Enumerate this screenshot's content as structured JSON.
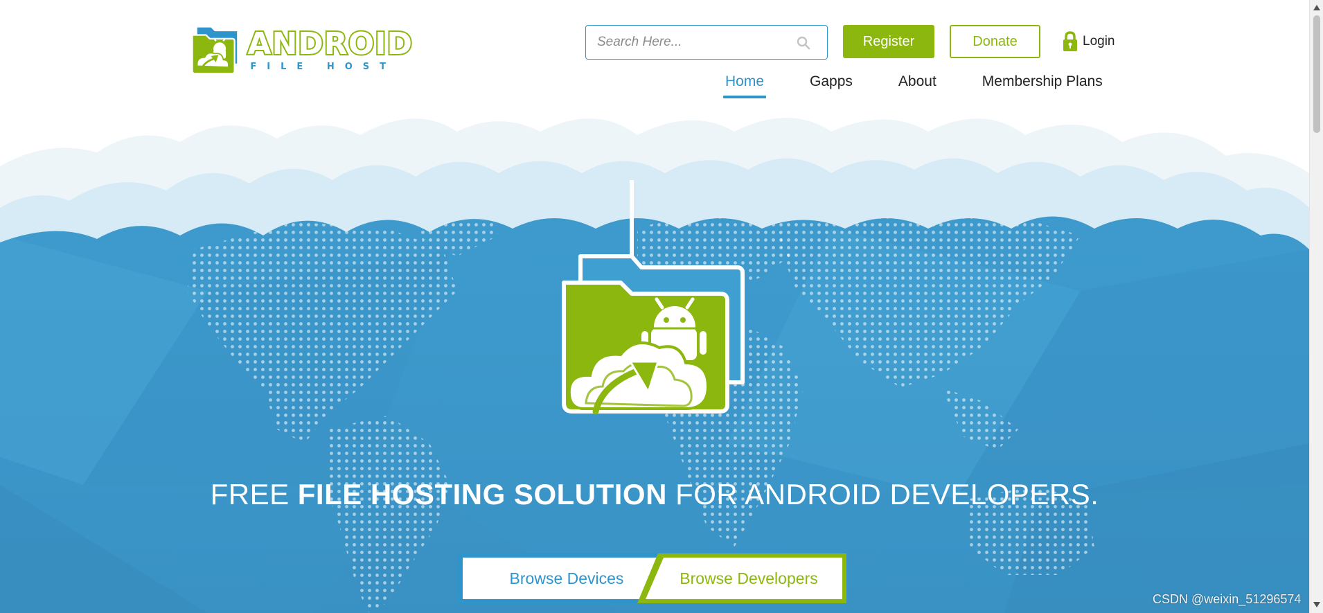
{
  "logo": {
    "word": "ANDROID",
    "sub": "FILE HOST"
  },
  "search": {
    "placeholder": "Search Here...",
    "value": ""
  },
  "header_buttons": {
    "register": "Register",
    "donate": "Donate",
    "login": "Login"
  },
  "nav": {
    "items": [
      {
        "label": "Home",
        "active": true
      },
      {
        "label": "Gapps",
        "active": false
      },
      {
        "label": "About",
        "active": false
      },
      {
        "label": "Membership Plans",
        "active": false
      }
    ]
  },
  "hero": {
    "headline_part1": "FREE ",
    "headline_strong": "FILE HOSTING SOLUTION",
    "headline_part2": " FOR ANDROID DEVELOPERS."
  },
  "cta": {
    "devices": "Browse Devices",
    "developers": "Browse Developers"
  },
  "watermark": "CSDN @weixin_51296574",
  "colors": {
    "brand_green": "#8cb70e",
    "brand_blue": "#2e95cc",
    "hero_blue": "#3f9fd0"
  },
  "icons": {
    "search": "search-icon",
    "login": "lock-icon",
    "logo": "android-folder-cloud-icon"
  }
}
